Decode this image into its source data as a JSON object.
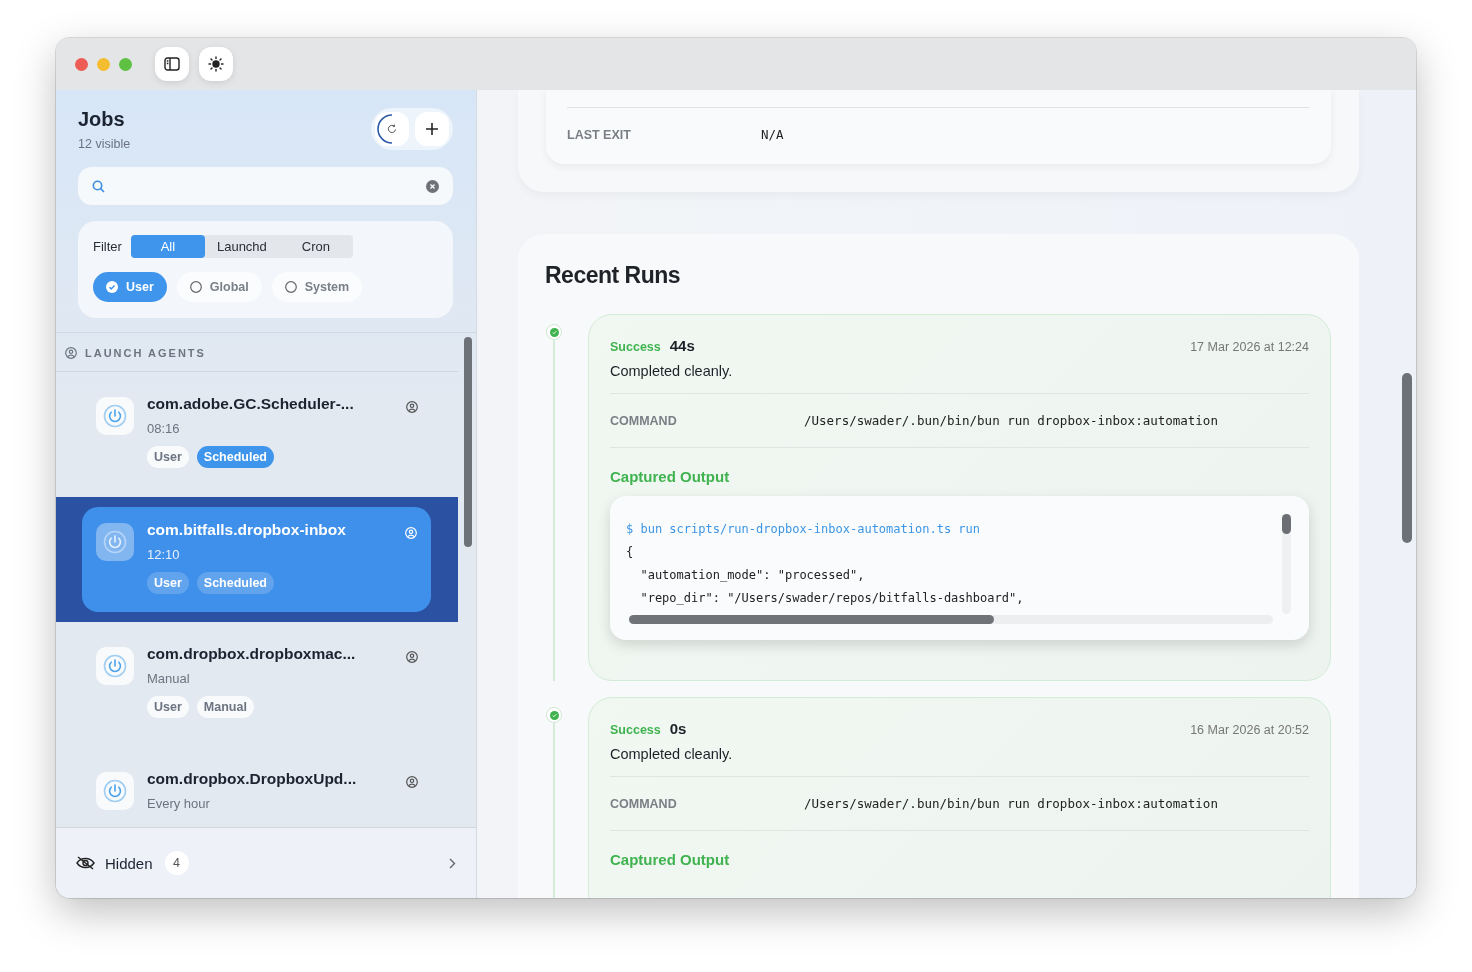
{
  "sidebar": {
    "title": "Jobs",
    "subtitle": "12 visible",
    "filter": {
      "label": "Filter",
      "segments": [
        {
          "label": "All",
          "selected": true
        },
        {
          "label": "Launchd",
          "selected": false
        },
        {
          "label": "Cron",
          "selected": false
        }
      ],
      "scopes": [
        {
          "label": "User",
          "selected": true
        },
        {
          "label": "Global",
          "selected": false
        },
        {
          "label": "System",
          "selected": false
        }
      ]
    },
    "section": "LAUNCH AGENTS",
    "jobs": [
      {
        "name": "com.adobe.GC.Scheduler-...",
        "schedule": "08:16",
        "selected": false,
        "tags": [
          {
            "label": "User",
            "kind": "plain"
          },
          {
            "label": "Scheduled",
            "kind": "accent"
          }
        ]
      },
      {
        "name": "com.bitfalls.dropbox-inbox",
        "schedule": "12:10",
        "selected": true,
        "tags": [
          {
            "label": "User",
            "kind": "plain"
          },
          {
            "label": "Scheduled",
            "kind": "accent"
          }
        ]
      },
      {
        "name": "com.dropbox.dropboxmac...",
        "schedule": "Manual",
        "selected": false,
        "tags": [
          {
            "label": "User",
            "kind": "plain"
          },
          {
            "label": "Manual",
            "kind": "plain"
          }
        ]
      },
      {
        "name": "com.dropbox.DropboxUpd...",
        "schedule": "Every hour",
        "selected": false
      }
    ],
    "hidden": {
      "label": "Hidden",
      "count": "4"
    }
  },
  "details": {
    "rows": [
      {
        "label": "LAST EXIT",
        "value": "N/A"
      }
    ]
  },
  "recent_runs": {
    "title": "Recent Runs",
    "runs": [
      {
        "status": "Success",
        "kind": "success",
        "duration": "44s",
        "message": "Completed cleanly.",
        "time": "17 Mar 2026 at 12:24",
        "command_label": "COMMAND",
        "command": "/Users/swader/.bun/bin/bun run dropbox-inbox:automation",
        "output_label": "Captured Output",
        "output": [
          "$ bun scripts/run-dropbox-inbox-automation.ts run",
          "{",
          "  \"automation_mode\": \"processed\",",
          "  \"repo_dir\": \"/Users/swader/repos/bitfalls-dashboard\","
        ]
      },
      {
        "status": "Success",
        "kind": "success",
        "duration": "0s",
        "message": "Completed cleanly.",
        "time": "16 Mar 2026 at 20:52",
        "command_label": "COMMAND",
        "command": "/Users/swader/.bun/bin/bun run dropbox-inbox:automation",
        "output_label": "Captured Output"
      }
    ]
  }
}
